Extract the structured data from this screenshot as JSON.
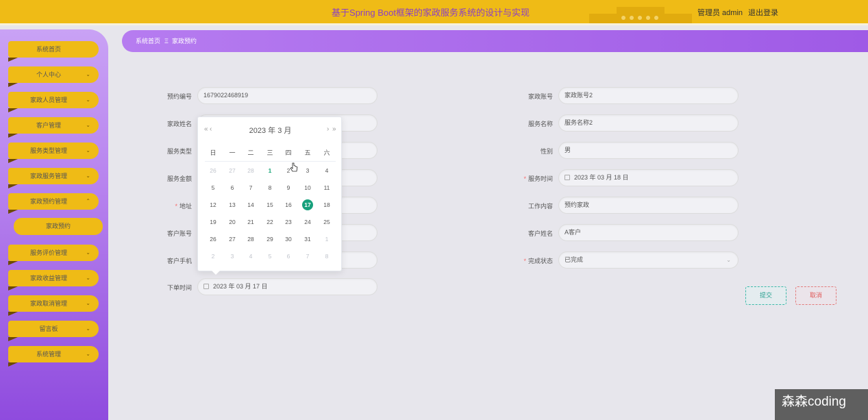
{
  "header": {
    "title": "基于Spring Boot框架的家政服务系统的设计与实现",
    "user": "管理员 admin",
    "logout": "退出登录"
  },
  "sidebar": {
    "items": [
      {
        "label": "系统首页",
        "chevron": ""
      },
      {
        "label": "个人中心",
        "chevron": "⌄"
      },
      {
        "label": "家政人员管理",
        "chevron": "⌄"
      },
      {
        "label": "客户管理",
        "chevron": "⌄"
      },
      {
        "label": "服务类型管理",
        "chevron": "⌄"
      },
      {
        "label": "家政服务管理",
        "chevron": "⌄"
      },
      {
        "label": "家政预约管理",
        "chevron": "⌃"
      },
      {
        "label": "服务评价管理",
        "chevron": "⌄"
      },
      {
        "label": "家政收益管理",
        "chevron": "⌄"
      },
      {
        "label": "家政取消管理",
        "chevron": "⌄"
      },
      {
        "label": "留言板",
        "chevron": "⌄"
      },
      {
        "label": "系统管理",
        "chevron": "⌄"
      }
    ],
    "active_sub": "家政预约"
  },
  "breadcrumb": {
    "home": "系统首页",
    "separator": "Ξ",
    "current": "家政预约"
  },
  "form": {
    "left": [
      {
        "label": "预约编号",
        "value": "1679022468919",
        "required": false
      },
      {
        "label": "家政姓名",
        "value": "",
        "required": false
      },
      {
        "label": "服务类型",
        "value": "",
        "required": false
      },
      {
        "label": "服务金额",
        "value": "",
        "required": false
      },
      {
        "label": "地址",
        "value": "",
        "required": true
      },
      {
        "label": "客户账号",
        "value": "",
        "required": false
      },
      {
        "label": "客户手机",
        "value": "",
        "required": false
      },
      {
        "label": "下单时间",
        "value": "2023 年 03 月 17 日",
        "required": false
      }
    ],
    "right": [
      {
        "label": "家政账号",
        "value": "家政账号2",
        "required": false
      },
      {
        "label": "服务名称",
        "value": "服务名称2",
        "required": false
      },
      {
        "label": "性别",
        "value": "男",
        "required": false
      },
      {
        "label": "服务时间",
        "value": "2023 年 03 月 18 日",
        "required": true
      },
      {
        "label": "工作内容",
        "value": "预约家政",
        "required": false
      },
      {
        "label": "客户姓名",
        "value": "A客户",
        "required": false
      },
      {
        "label": "完成状态",
        "value": "已完成",
        "required": true
      }
    ],
    "submit": "提交",
    "cancel": "取消"
  },
  "datepicker": {
    "title": "2023 年 3 月",
    "prev_year": "«",
    "prev_month": "‹",
    "next_month": "›",
    "next_year": "»",
    "weekdays": [
      "日",
      "一",
      "二",
      "三",
      "四",
      "五",
      "六"
    ],
    "weeks": [
      [
        "26",
        "27",
        "28",
        "1",
        "2",
        "3",
        "4"
      ],
      [
        "5",
        "6",
        "7",
        "8",
        "9",
        "10",
        "11"
      ],
      [
        "12",
        "13",
        "14",
        "15",
        "16",
        "17",
        "18"
      ],
      [
        "19",
        "20",
        "21",
        "22",
        "23",
        "24",
        "25"
      ],
      [
        "26",
        "27",
        "28",
        "29",
        "30",
        "31",
        "1"
      ],
      [
        "2",
        "3",
        "4",
        "5",
        "6",
        "7",
        "8"
      ]
    ],
    "selected": "17",
    "today": "1"
  },
  "watermark": "森森coding",
  "colors": {
    "header": "#efbb16",
    "title": "#8b3fc5",
    "sidebar": "#b783ee",
    "selected_day": "#17a07c"
  }
}
